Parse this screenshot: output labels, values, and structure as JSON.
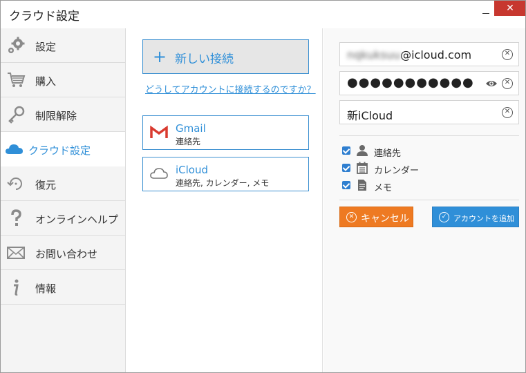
{
  "window": {
    "title": "クラウド設定",
    "minimize": "—",
    "close": "✕"
  },
  "sidebar": {
    "items": [
      {
        "label": "設定",
        "icon": "gear-icon"
      },
      {
        "label": "購入",
        "icon": "cart-icon"
      },
      {
        "label": "制限解除",
        "icon": "key-icon"
      },
      {
        "label": "クラウド設定",
        "icon": "cloud-icon",
        "active": true
      },
      {
        "label": "復元",
        "icon": "restore-icon"
      },
      {
        "label": "オンラインヘルプ",
        "icon": "question-icon"
      },
      {
        "label": "お問い合わせ",
        "icon": "envelope-icon"
      },
      {
        "label": "情報",
        "icon": "info-icon"
      }
    ]
  },
  "middle": {
    "new_connection": {
      "plus": "+",
      "label": "新しい接続"
    },
    "help_link": "どうしてアカウントに接続するのですか？",
    "services": [
      {
        "name": "Gmail",
        "sub": "連絡先",
        "icon": "gmail-icon"
      },
      {
        "name": "iCloud",
        "sub": "連絡先, カレンダー, メモ",
        "icon": "icloud-icon"
      }
    ]
  },
  "form": {
    "email_local": "nqkuksuu",
    "email_domain": "@icloud.com",
    "password": "●●●●●●●●●●●",
    "account_name": "新iCloud",
    "clear_glyph": "✕",
    "options": [
      {
        "label": "連絡先",
        "checked": true,
        "icon": "person-icon"
      },
      {
        "label": "カレンダー",
        "checked": true,
        "icon": "calendar-icon"
      },
      {
        "label": "メモ",
        "checked": true,
        "icon": "note-icon"
      }
    ],
    "cancel_label": "キャンセル",
    "add_label": "アカウントを追加",
    "cancel_glyph": "✕",
    "add_glyph": "✓"
  },
  "colors": {
    "accent": "#2f8fd8",
    "cancel": "#ee7a22",
    "close": "#c7372f"
  }
}
